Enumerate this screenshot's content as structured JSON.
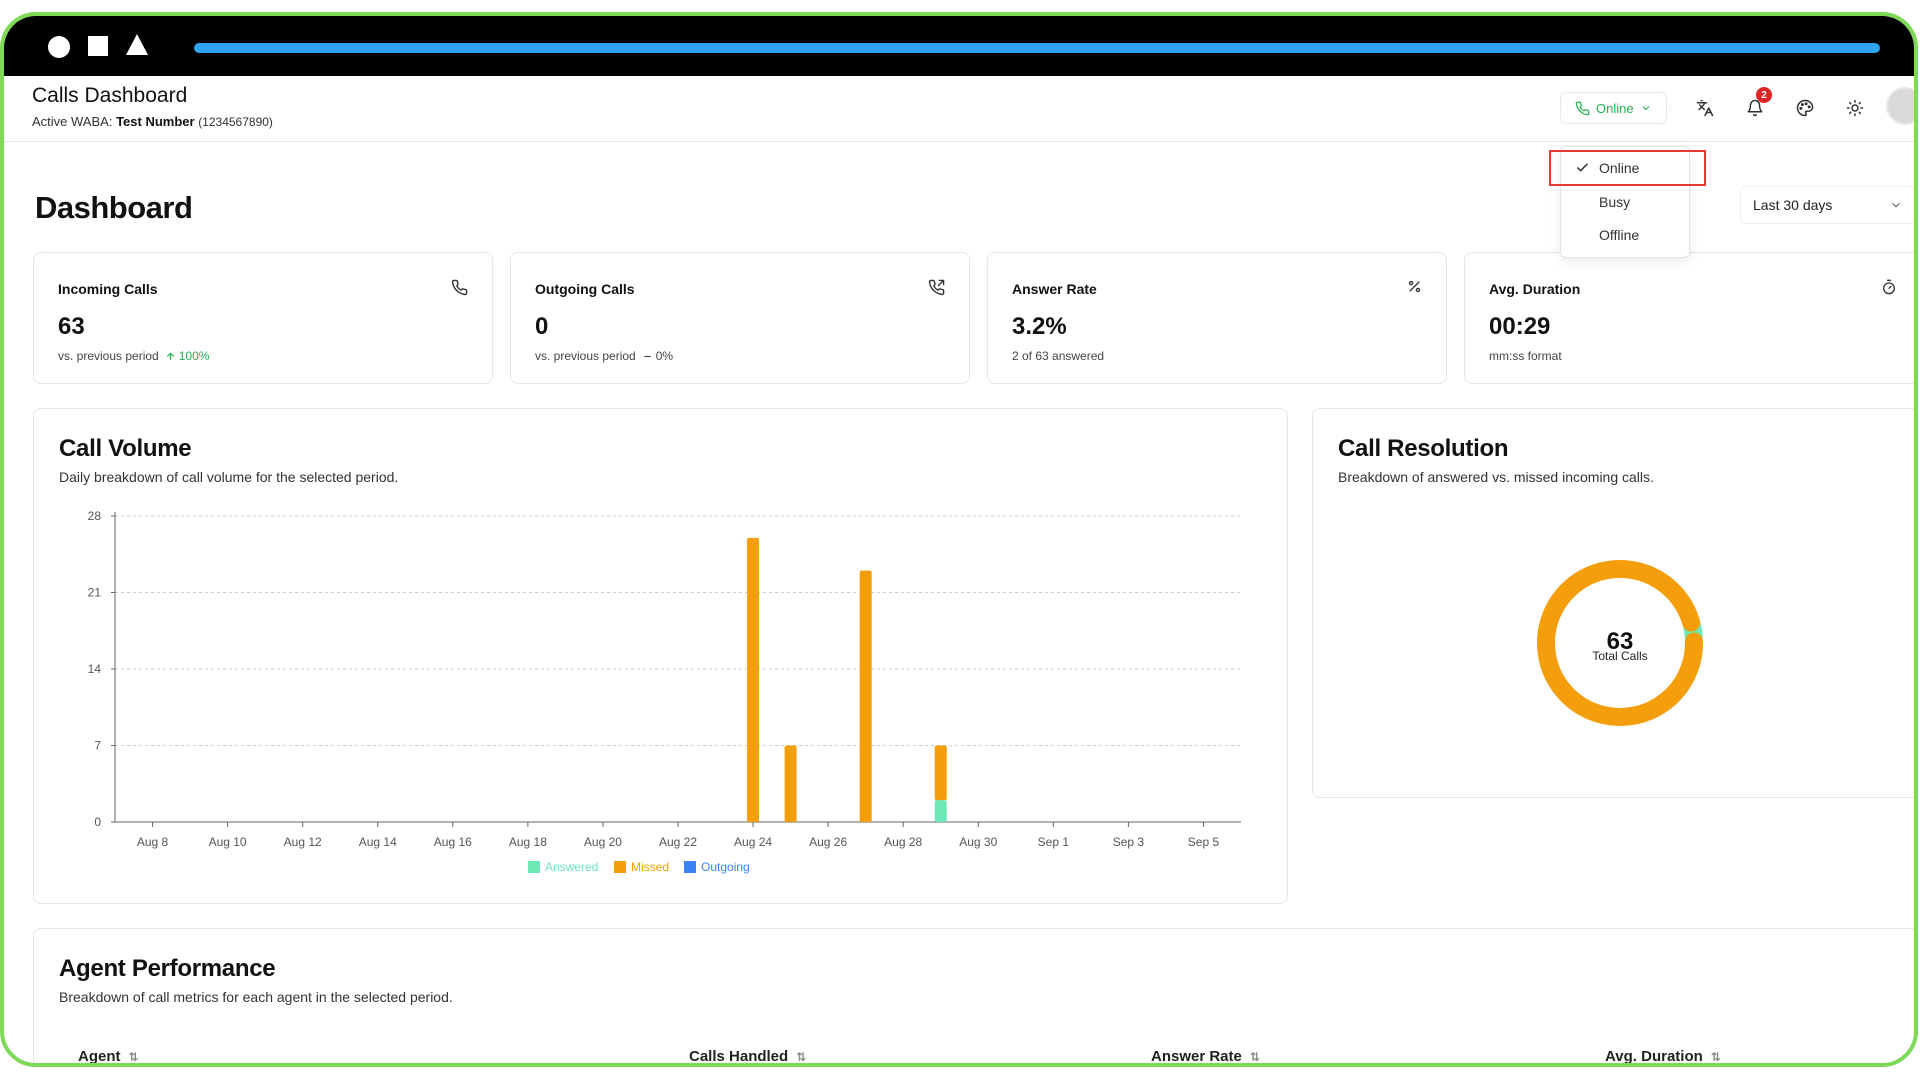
{
  "window": {
    "progress": 1.0,
    "colors": {
      "frame": "#7ed957",
      "progress": "#2ea4f2"
    }
  },
  "header": {
    "title": "Calls Dashboard",
    "waba_label": "Active WABA:",
    "waba_name": "Test Number",
    "waba_number": "(1234567890)",
    "status_label": "Online",
    "notifications_count": "2"
  },
  "status_menu": {
    "selected": "Online",
    "options": [
      "Online",
      "Busy",
      "Offline"
    ]
  },
  "page": {
    "title": "Dashboard",
    "range": "Last 30 days"
  },
  "cards": [
    {
      "label": "Incoming Calls",
      "value": "63",
      "note": "vs. previous period",
      "trend": "100%",
      "icon": "phone-icon"
    },
    {
      "label": "Outgoing Calls",
      "value": "0",
      "note": "vs. previous period",
      "trend": "0%",
      "icon": "phone-outgoing-icon"
    },
    {
      "label": "Answer Rate",
      "value": "3.2%",
      "note": "2 of 63 answered",
      "icon": "percent-icon"
    },
    {
      "label": "Avg. Duration",
      "value": "00:29",
      "note": "mm:ss format",
      "icon": "timer-icon"
    }
  ],
  "call_volume": {
    "title": "Call Volume",
    "subtitle": "Daily breakdown of call volume for the selected period."
  },
  "call_resolution": {
    "title": "Call Resolution",
    "subtitle": "Breakdown of answered vs. missed incoming calls.",
    "total": "63",
    "total_label": "Total Calls"
  },
  "agent_performance": {
    "title": "Agent Performance",
    "subtitle": "Breakdown of call metrics for each agent in the selected period.",
    "columns": [
      "Agent",
      "Calls Handled",
      "Answer Rate",
      "Avg. Duration"
    ]
  },
  "chart_data": [
    {
      "type": "bar",
      "stacked": true,
      "title": "Call Volume",
      "ylim": [
        0,
        28
      ],
      "yticks": [
        0,
        7,
        14,
        21,
        28
      ],
      "x": [
        "Aug 7",
        "Aug 8",
        "Aug 9",
        "Aug 10",
        "Aug 11",
        "Aug 12",
        "Aug 13",
        "Aug 14",
        "Aug 15",
        "Aug 16",
        "Aug 17",
        "Aug 18",
        "Aug 19",
        "Aug 20",
        "Aug 21",
        "Aug 22",
        "Aug 23",
        "Aug 24",
        "Aug 25",
        "Aug 26",
        "Aug 27",
        "Aug 28",
        "Aug 29",
        "Aug 30",
        "Aug 31",
        "Sep 1",
        "Sep 2",
        "Sep 3",
        "Sep 4",
        "Sep 5",
        "Sep 6"
      ],
      "xtick_labels": [
        "Aug 8",
        "Aug 10",
        "Aug 12",
        "Aug 14",
        "Aug 16",
        "Aug 18",
        "Aug 20",
        "Aug 22",
        "Aug 24",
        "Aug 26",
        "Aug 28",
        "Aug 30",
        "Sep 1",
        "Sep 3",
        "Sep 5"
      ],
      "series": [
        {
          "name": "Answered",
          "color": "#6ee7b7",
          "values": [
            0,
            0,
            0,
            0,
            0,
            0,
            0,
            0,
            0,
            0,
            0,
            0,
            0,
            0,
            0,
            0,
            0,
            0,
            0,
            0,
            0,
            0,
            2,
            0,
            0,
            0,
            0,
            0,
            0,
            0,
            0
          ]
        },
        {
          "name": "Missed",
          "color": "#f59e0b",
          "values": [
            0,
            0,
            0,
            0,
            0,
            0,
            0,
            0,
            0,
            0,
            0,
            0,
            0,
            0,
            0,
            0,
            0,
            26,
            7,
            0,
            23,
            0,
            5,
            0,
            0,
            0,
            0,
            0,
            0,
            0,
            0
          ]
        },
        {
          "name": "Outgoing",
          "color": "#3b82f6",
          "values": [
            0,
            0,
            0,
            0,
            0,
            0,
            0,
            0,
            0,
            0,
            0,
            0,
            0,
            0,
            0,
            0,
            0,
            0,
            0,
            0,
            0,
            0,
            0,
            0,
            0,
            0,
            0,
            0,
            0,
            0,
            0
          ]
        }
      ],
      "grid": true,
      "legend": "bottom"
    },
    {
      "type": "pie",
      "donut": true,
      "title": "Call Resolution",
      "categories": [
        "Answered",
        "Missed"
      ],
      "values": [
        2,
        61
      ],
      "colors": [
        "#6ee7b7",
        "#f59e0b"
      ],
      "center_value": "63",
      "center_label": "Total Calls"
    }
  ]
}
